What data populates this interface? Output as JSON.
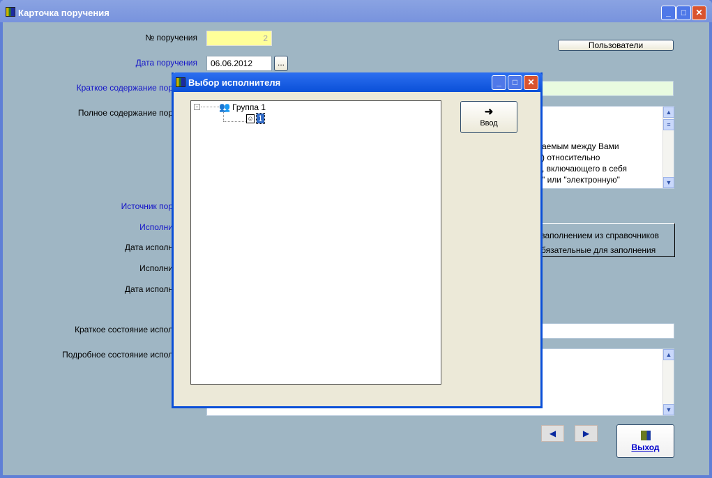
{
  "main": {
    "title": "Карточка поручения",
    "labels": {
      "number": "№ поручения",
      "date": "Дата поручения",
      "short": "Краткое содержание пор",
      "full": "Полное содержание пор",
      "source": "Источник пор",
      "executor_b": "Исполни",
      "exec_date": "Дата исполн",
      "executor": "Исполни",
      "exec_date2": "Дата исполн",
      "short_state": "Краткое состояние испол",
      "full_state": "Подробное состояние испол"
    },
    "number_value": "2",
    "date_value": "06.06.2012",
    "date_picker": "...",
    "users_button": "Пользователи",
    "full_text_lines": [
      "аемым между Вами",
      ") относительно",
      ",  включающего в себя",
      "\"  или \"электронную\"",
      ".."
    ],
    "info_lines": [
      "заполнением из справочников",
      "бязательные для заполнения"
    ],
    "exit_button": "Выход"
  },
  "dialog": {
    "title": "Выбор исполнителя",
    "tree": {
      "group": "Группа 1",
      "child": "1"
    },
    "enter_button": "Ввод"
  },
  "colors": {
    "bg": "#9fb6c4",
    "yellow": "#ffff99",
    "green": "#e8fbe0"
  }
}
